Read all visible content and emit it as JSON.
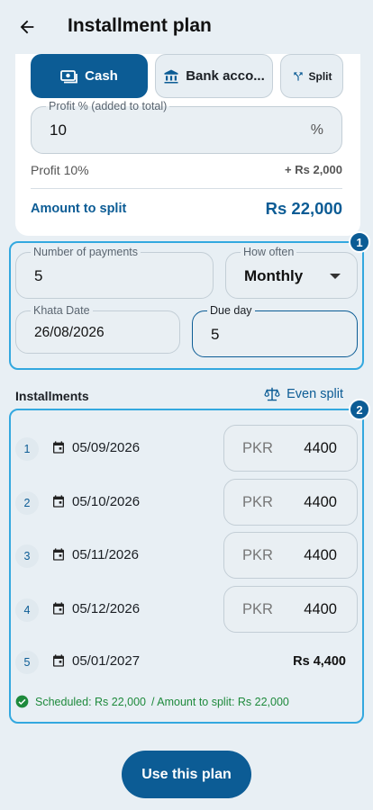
{
  "header": {
    "title": "Installment plan",
    "back_icon": "arrow-left-icon"
  },
  "payment_method": {
    "options": [
      {
        "label": "Cash",
        "icon": "cash-icon",
        "selected": true
      },
      {
        "label": "Bank acco...",
        "icon": "bank-icon",
        "selected": false
      },
      {
        "label": "Split",
        "icon": "split-icon",
        "selected": false
      }
    ]
  },
  "profit": {
    "label": "Profit % (added to total)",
    "value": "10",
    "unit": "%",
    "summary_label": "Profit 10%",
    "summary_value": "+ Rs 2,000"
  },
  "amount_to_split": {
    "label": "Amount to split",
    "value": "Rs 22,000"
  },
  "plan": {
    "payments_label": "Number of payments",
    "payments_value": "5",
    "frequency_label": "How often",
    "frequency_value": "Monthly",
    "khata_label": "Khata Date",
    "khata_value": "26/08/2026",
    "due_label": "Due day",
    "due_value": "5"
  },
  "installments": {
    "title": "Installments",
    "even_split_label": "Even split",
    "currency": "PKR",
    "rows": [
      {
        "index": "1",
        "date": "05/09/2026",
        "amount": "4400"
      },
      {
        "index": "2",
        "date": "05/10/2026",
        "amount": "4400"
      },
      {
        "index": "3",
        "date": "05/11/2026",
        "amount": "4400"
      },
      {
        "index": "4",
        "date": "05/12/2026",
        "amount": "4400"
      }
    ],
    "final_row": {
      "index": "5",
      "date": "05/01/2027",
      "amount": "Rs 4,400"
    },
    "scheduled_text": "Scheduled: Rs 22,000",
    "split_text": "/ Amount to split: Rs 22,000"
  },
  "annotations": {
    "badge_1": "1",
    "badge_2": "2"
  },
  "footer": {
    "primary_label": "Use this plan"
  },
  "colors": {
    "primary": "#0c5c95",
    "highlight": "#33a8df",
    "success": "#1e8a3c",
    "background": "#e8eff4"
  }
}
